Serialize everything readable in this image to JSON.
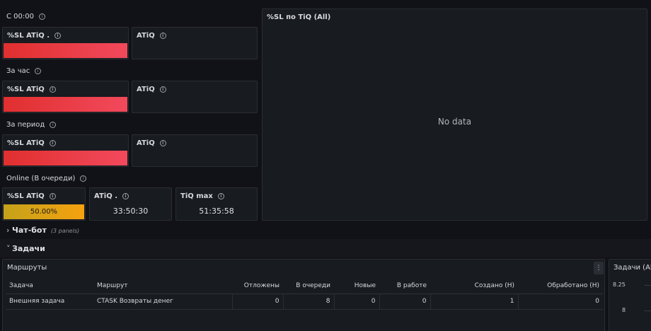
{
  "groups": {
    "since_midnight": "С 00:00",
    "per_hour": "За час",
    "per_period": "За период",
    "online": "Online (В очереди)"
  },
  "panels": {
    "sl_atiq_dot": "%SL ATiQ .",
    "sl_atiq": "%SL ATiQ",
    "atiq": "ATiQ",
    "atiq_dot": "ATiQ .",
    "tiq_max": "TiQ max",
    "chart_title": "%SL по TiQ (All)",
    "no_data": "No data",
    "online_sl_value": "50.00%",
    "online_atiq_value": "33:50:30",
    "online_tiq_max_value": "51:35:58",
    "online_sl_fill": 1.0
  },
  "rows": {
    "chatbot": "Чат-бот",
    "chatbot_count": "(3 panels)",
    "tasks": "Задачи"
  },
  "routes_table": {
    "title": "Маршруты",
    "menu_icon": "⋮",
    "columns": [
      "Задача",
      "Маршрут",
      "Отложены",
      "В очереди",
      "Новые",
      "В работе",
      "Создано (Н)",
      "Обработано (Н)"
    ],
    "rows": [
      [
        "Внешняя задача",
        "CTASK Возвраты денег",
        "0",
        "8",
        "0",
        "0",
        "1",
        "0"
      ]
    ]
  },
  "tasks_chart": {
    "title": "Задачи (All)",
    "ticks": [
      "8.25",
      "8"
    ]
  },
  "colors": {
    "red": "#e02f2f",
    "yellow": "#c4a21a",
    "background": "#111217",
    "panel": "#181b1f"
  }
}
